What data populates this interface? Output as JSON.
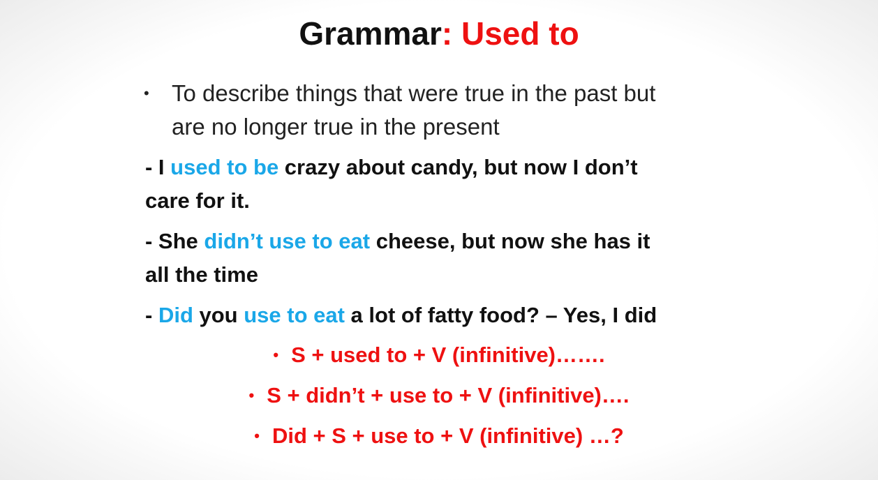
{
  "title": {
    "main": "Grammar",
    "colon_part": ": Used to",
    "colors": {
      "main": "#111111",
      "accent": "#ee1111"
    }
  },
  "intro": {
    "bullet": "•",
    "line1": "To describe things that were true in the past but",
    "line2": "are no longer true in the present"
  },
  "examples": [
    {
      "prefix": "- I ",
      "highlight1": "used to be",
      "rest1": " crazy about candy, but now I don’t",
      "line2": "care for it."
    },
    {
      "prefix": " - She ",
      "highlight1": "didn’t use to eat",
      "rest1": " cheese, but now she has it",
      "line2": "all the time"
    },
    {
      "prefix": " - ",
      "highlight1": "Did",
      "mid": " you ",
      "highlight2": "use to eat",
      "rest1": " a lot of fatty food? – Yes, I did"
    }
  ],
  "formulas": {
    "bullet": "•",
    "items": [
      "S + used to + V (infinitive)…….",
      "S + didn’t + use to + V (infinitive)….",
      "Did + S + use to + V (infinitive) …?"
    ]
  },
  "highlight_color": "#1aa7e8"
}
